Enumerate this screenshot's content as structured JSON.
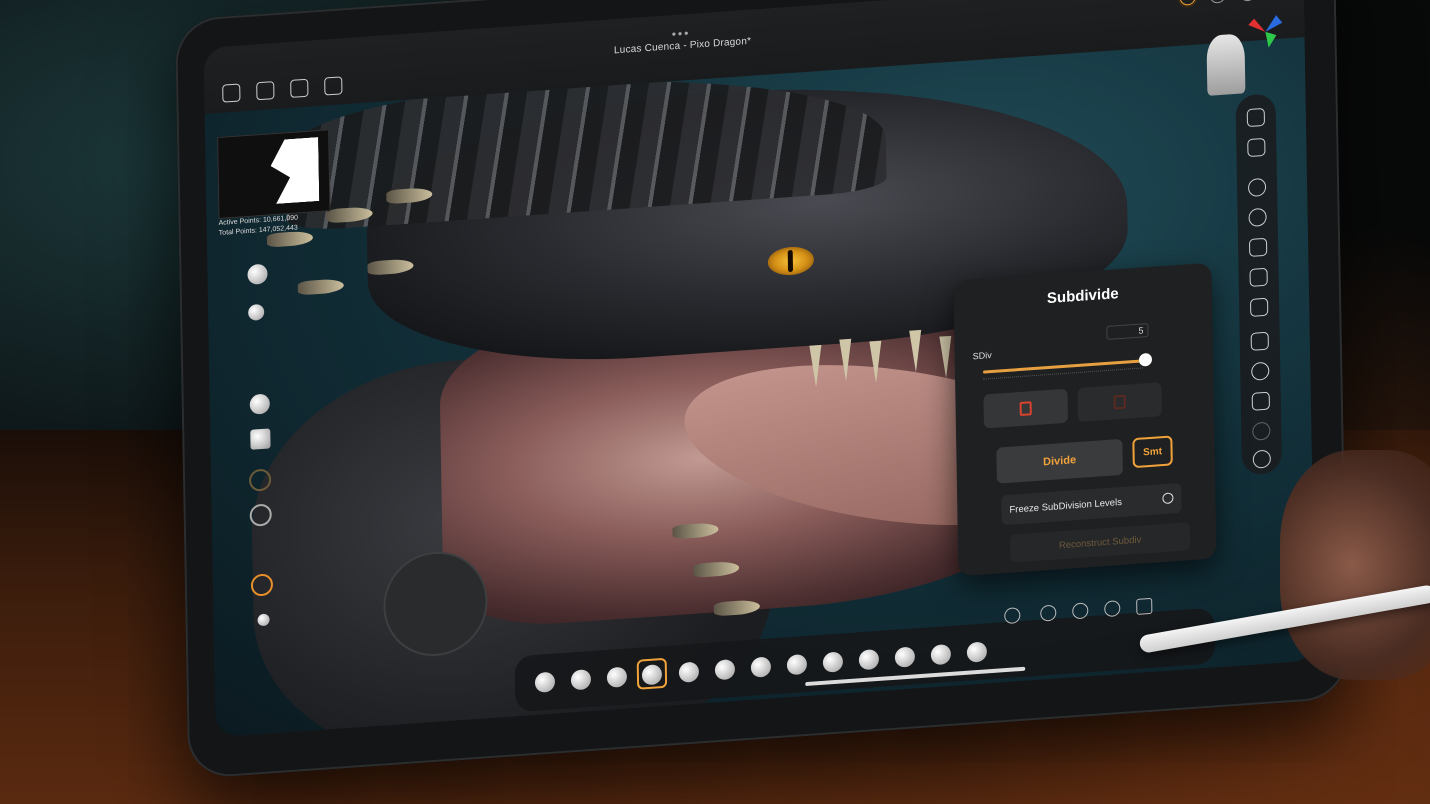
{
  "window": {
    "title": "Lucas Cuenca - Pixo Dragon*"
  },
  "toolbar_top_left": [
    {
      "name": "home-icon"
    },
    {
      "name": "save-icon"
    },
    {
      "name": "import-icon"
    },
    {
      "name": "share-icon"
    }
  ],
  "toolbar_top_right": [
    {
      "name": "brush-settings-icon",
      "active": true
    },
    {
      "name": "camera-icon"
    },
    {
      "name": "power-icon"
    },
    {
      "name": "settings-icon"
    }
  ],
  "stats": {
    "active_points": "Active Points: 10,661,090",
    "total_points": "Total Points: 147,052,443"
  },
  "subdivide_panel": {
    "title": "Subdivide",
    "sdiv_label": "SDiv",
    "sdiv_value": "5",
    "divide_label": "Divide",
    "smt_label": "Smt",
    "freeze_label": "Freeze SubDivision Levels",
    "reconstruct_label": "Reconstruct Subdiv"
  },
  "colors": {
    "accent": "#f0a23a",
    "delete": "#d8432e"
  }
}
